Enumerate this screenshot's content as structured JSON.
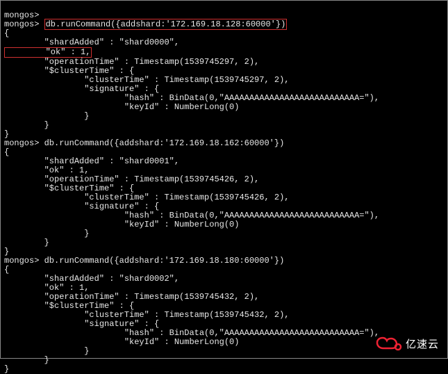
{
  "terminal": {
    "block0": {
      "line1": "mongos>"
    },
    "block1": {
      "prompt": "mongos> ",
      "cmd": "db.runCommand({addshard:'172.169.18.128:60000'})",
      "open": "{",
      "l1": "        \"shardAdded\" : \"shard0000\",",
      "l2": "        \"ok\" : 1,",
      "l3": "        \"operationTime\" : Timestamp(1539745297, 2),",
      "l4": "        \"$clusterTime\" : {",
      "l5": "                \"clusterTime\" : Timestamp(1539745297, 2),",
      "l6": "                \"signature\" : {",
      "l7": "                        \"hash\" : BinData(0,\"AAAAAAAAAAAAAAAAAAAAAAAAAAA=\"),",
      "l8": "                        \"keyId\" : NumberLong(0)",
      "l9": "                }",
      "l10": "        }",
      "close": "}"
    },
    "block2": {
      "prompt": "mongos> ",
      "cmd": "db.runCommand({addshard:'172.169.18.162:60000'})",
      "open": "{",
      "l1": "        \"shardAdded\" : \"shard0001\",",
      "l2": "        \"ok\" : 1,",
      "l3": "        \"operationTime\" : Timestamp(1539745426, 2),",
      "l4": "        \"$clusterTime\" : {",
      "l5": "                \"clusterTime\" : Timestamp(1539745426, 2),",
      "l6": "                \"signature\" : {",
      "l7": "                        \"hash\" : BinData(0,\"AAAAAAAAAAAAAAAAAAAAAAAAAAA=\"),",
      "l8": "                        \"keyId\" : NumberLong(0)",
      "l9": "                }",
      "l10": "        }",
      "close": "}"
    },
    "block3": {
      "prompt": "mongos> ",
      "cmd": "db.runCommand({addshard:'172.169.18.180:60000'})",
      "open": "{",
      "l1": "        \"shardAdded\" : \"shard0002\",",
      "l2": "        \"ok\" : 1,",
      "l3": "        \"operationTime\" : Timestamp(1539745432, 2),",
      "l4": "        \"$clusterTime\" : {",
      "l5": "                \"clusterTime\" : Timestamp(1539745432, 2),",
      "l6": "                \"signature\" : {",
      "l7": "                        \"hash\" : BinData(0,\"AAAAAAAAAAAAAAAAAAAAAAAAAAA=\"),",
      "l8": "                        \"keyId\" : NumberLong(0)",
      "l9": "                }",
      "l10": "        }",
      "close": "}"
    }
  },
  "watermark": {
    "text": "亿速云"
  }
}
